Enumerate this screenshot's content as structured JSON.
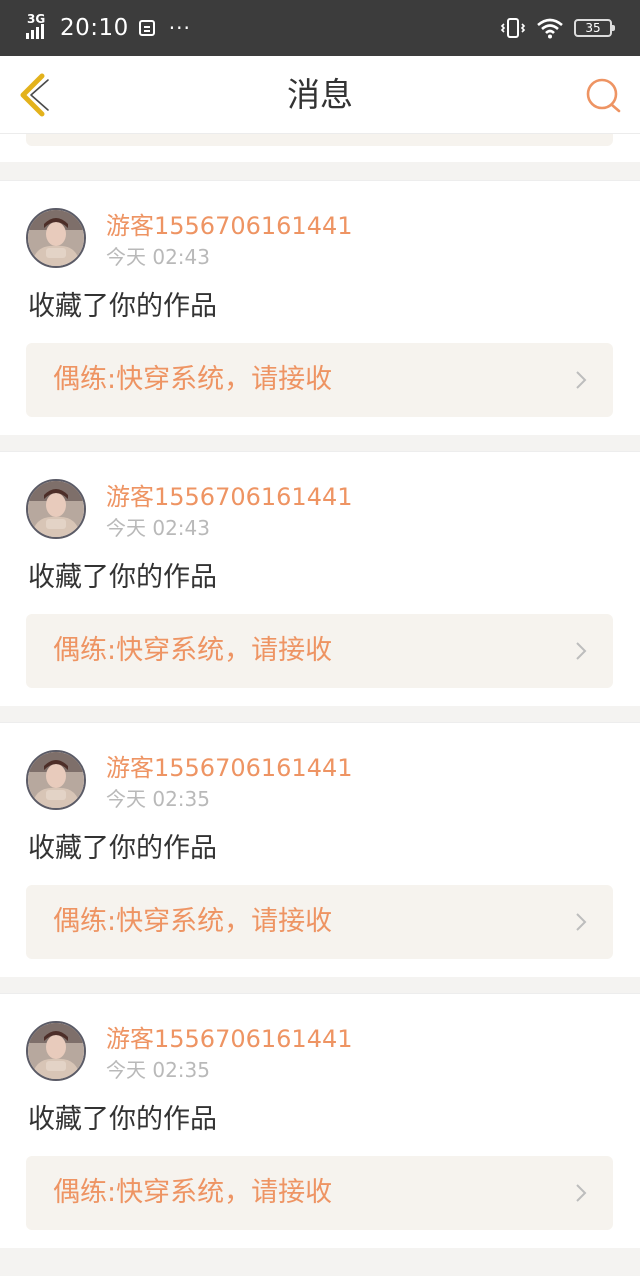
{
  "status_bar": {
    "network": "3G",
    "time": "20:10",
    "more": "···",
    "battery": "35"
  },
  "nav": {
    "title": "消息"
  },
  "messages": [
    {
      "username": "游客1556706161441",
      "time": "今天 02:43",
      "action": "收藏了你的作品",
      "work": "偶练:快穿系统，请接收"
    },
    {
      "username": "游客1556706161441",
      "time": "今天 02:43",
      "action": "收藏了你的作品",
      "work": "偶练:快穿系统，请接收"
    },
    {
      "username": "游客1556706161441",
      "time": "今天 02:35",
      "action": "收藏了你的作品",
      "work": "偶练:快穿系统，请接收"
    },
    {
      "username": "游客1556706161441",
      "time": "今天 02:35",
      "action": "收藏了你的作品",
      "work": "偶练:快穿系统，请接收"
    }
  ],
  "colors": {
    "accent": "#ee9463",
    "back_icon": "#e3b21c",
    "card_link_bg": "#f6f3ee",
    "status_bar_bg": "#3c3c3c"
  },
  "icons": {
    "back": "chevron-left-icon",
    "search": "search-icon",
    "link": "chevron-right-icon",
    "vibrate": "vibrate-icon",
    "wifi": "wifi-icon",
    "battery": "battery-icon",
    "signal": "signal-icon",
    "notification": "notification-icon"
  }
}
